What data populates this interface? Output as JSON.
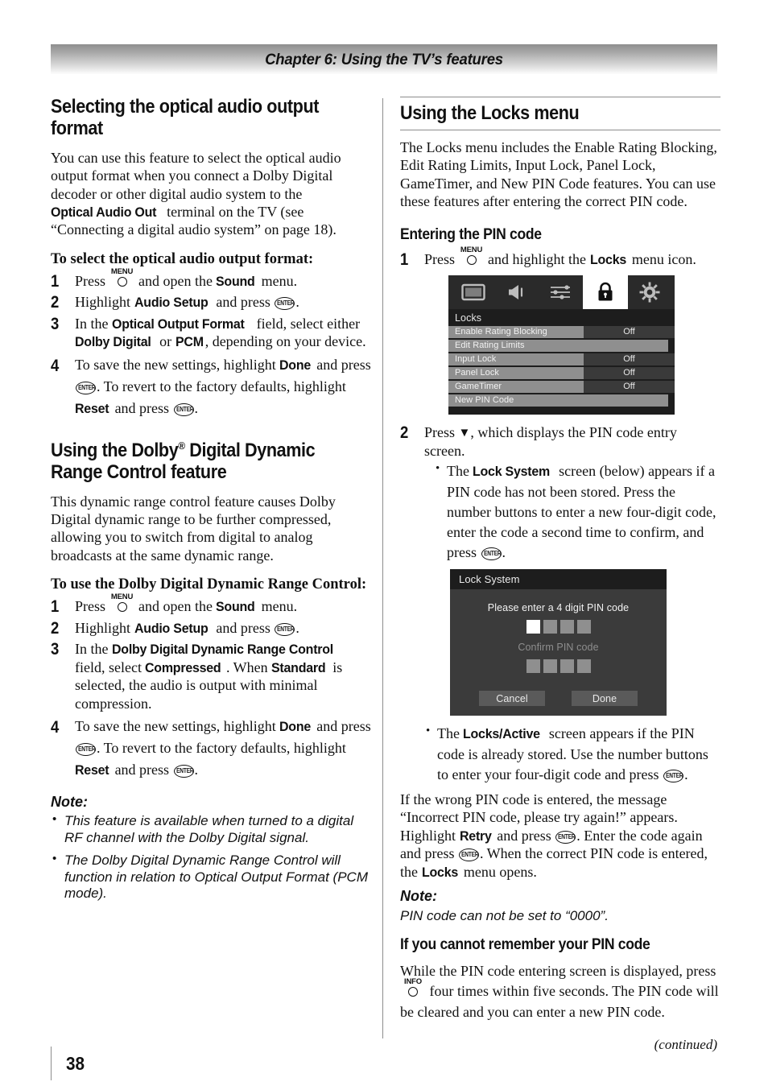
{
  "chapter": {
    "title": "Chapter 6: Using the TV’s features"
  },
  "footer": {
    "continued": "(continued)",
    "page_number": "38"
  },
  "left_column": {
    "section1": {
      "heading": "Selecting the optical audio output format",
      "intro_a": "You can use this feature to select the optical audio output format when you connect a Dolby Digital decoder or other digital audio system to the ",
      "intro_bold": "Optical Audio Out",
      "intro_b": " terminal on the TV (see “Connecting a digital audio system” on page 18).",
      "task_heading": "To select the optical audio output format:",
      "steps": [
        {
          "num": "1",
          "t1": "Press ",
          "key": "MENU",
          "t2": " and open the ",
          "b1": "Sound",
          "t3": " menu."
        },
        {
          "num": "2",
          "t1": "Highlight ",
          "b1": "Audio Setup",
          "t2": " and press ",
          "key": "ENTER",
          "t3": "."
        },
        {
          "num": "3",
          "t1": "In the ",
          "b1": "Optical Output Format",
          "t2": " field, select either ",
          "b2": "Dolby Digital",
          "t3": " or ",
          "b3": "PCM",
          "t4": ", depending on your device."
        },
        {
          "num": "4",
          "t1": "To save the new settings, highlight ",
          "b1": "Done",
          "t2": " and press ",
          "key": "ENTER",
          "t3": ". To revert to the factory defaults, highlight ",
          "b2": "Reset",
          "t4": " and press ",
          "key2": "ENTER",
          "t5": "."
        }
      ]
    },
    "section2": {
      "heading_pre": "Using the Dolby",
      "heading_sup": "®",
      "heading_post": " Digital Dynamic Range Control feature",
      "intro": "This dynamic range control feature causes Dolby Digital dynamic range to be further compressed, allowing you to switch from digital to analog broadcasts at the same dynamic range.",
      "task_heading": "To use the Dolby Digital Dynamic Range Control:",
      "steps": [
        {
          "num": "1",
          "t1": "Press ",
          "key": "MENU",
          "t2": " and open the ",
          "b1": "Sound",
          "t3": " menu."
        },
        {
          "num": "2",
          "t1": "Highlight ",
          "b1": "Audio Setup",
          "t2": " and press ",
          "key": "ENTER",
          "t3": "."
        },
        {
          "num": "3",
          "t1": "In the ",
          "b1": "Dolby Digital Dynamic Range Control",
          "t2": " field, select ",
          "b2": "Compressed",
          "t3": ". When ",
          "b3": "Standard",
          "t4": " is selected, the audio is output with minimal compression."
        },
        {
          "num": "4",
          "t1": "To save the new settings, highlight ",
          "b1": "Done",
          "t2": " and press ",
          "key": "ENTER",
          "t3": ". To revert to the factory defaults, highlight ",
          "b2": "Reset",
          "t4": " and press ",
          "key2": "ENTER",
          "t5": "."
        }
      ],
      "note_heading": "Note:",
      "notes": [
        "This feature is available when turned to a digital RF channel with the Dolby Digital signal.",
        "The Dolby Digital Dynamic Range Control will function in relation to Optical Output Format (PCM mode)."
      ]
    }
  },
  "right_column": {
    "section1": {
      "heading": "Using the Locks menu",
      "intro": "The Locks menu includes the Enable Rating Blocking, Edit Rating Limits, Input Lock, Panel Lock, GameTimer, and New PIN Code features. You can use these features after entering the correct PIN code."
    },
    "section2": {
      "heading": "Entering the PIN code",
      "step1": {
        "num": "1",
        "t1": "Press ",
        "key": "MENU",
        "t2": " and highlight the ",
        "b1": "Locks",
        "t3": " menu icon."
      },
      "step2": {
        "num": "2",
        "t1": "Press ",
        "arrow": "▼",
        "t2": ", which displays the PIN code entry screen."
      },
      "bullet1": {
        "t1": "The ",
        "b1": "Lock System",
        "t2": " screen (below) appears if a PIN code has not been stored. Press the number buttons to enter a new four-digit code, enter the code a second time to confirm, and press ",
        "key": "ENTER",
        "t3": "."
      },
      "bullet2": {
        "t1": "The ",
        "b1": "Locks/Active",
        "t2": " screen appears if the PIN code is already stored. Use the number buttons to enter your four-digit code and press ",
        "key": "ENTER",
        "t3": "."
      },
      "para": {
        "t1": "If the wrong PIN code is entered, the message “Incorrect PIN code, please try again!” appears. Highlight ",
        "b1": "Retry",
        "t2": " and press ",
        "key": "ENTER",
        "t3": ". Enter the code again and press ",
        "key2": "ENTER",
        "t4": ". When the correct PIN code is entered, the ",
        "b2": "Locks",
        "t5": " menu opens."
      },
      "note_heading": "Note:",
      "note_body": "PIN code can not be set to “0000”."
    },
    "section3": {
      "heading": "If you cannot remember your PIN code",
      "t1": "While the PIN code entering screen is displayed, press ",
      "key": "INFO",
      "t2": " four times within five seconds. The PIN code will be cleared and you can enter a new PIN code."
    }
  },
  "tv_menu": {
    "icons": [
      "picture-icon",
      "audio-icon",
      "settings-sliders-icon",
      "lock-icon",
      "gear-icon"
    ],
    "active_icon": "lock-icon",
    "heading": "Locks",
    "rows": [
      {
        "label": "Enable Rating Blocking",
        "value": "Off",
        "wide": false
      },
      {
        "label": "Edit Rating Limits",
        "value": "",
        "wide": true
      },
      {
        "label": "Input Lock",
        "value": "Off",
        "wide": false
      },
      {
        "label": "Panel Lock",
        "value": "Off",
        "wide": false
      },
      {
        "label": "GameTimer",
        "value": "Off",
        "wide": false
      },
      {
        "label": "New PIN Code",
        "value": "",
        "wide": true
      }
    ],
    "colors": {
      "background": "#1d1d1d",
      "label_band": "#8f8f8f",
      "value_band": "#3a3a3a",
      "active": "#ffffff"
    }
  },
  "lock_dialog": {
    "title": "Lock System",
    "prompt": "Please enter a 4 digit PIN code",
    "confirm_label": "Confirm PIN code",
    "pin_boxes": [
      "active",
      "empty",
      "empty",
      "empty"
    ],
    "confirm_boxes": [
      "empty",
      "empty",
      "empty",
      "empty"
    ],
    "cancel_label": "Cancel",
    "done_label": "Done",
    "colors": {
      "background": "#3b3b3b",
      "title_bar": "#1d1d1d",
      "box": "#8f8f8f",
      "box_active": "#ffffff",
      "button": "#5a5a5a"
    }
  }
}
